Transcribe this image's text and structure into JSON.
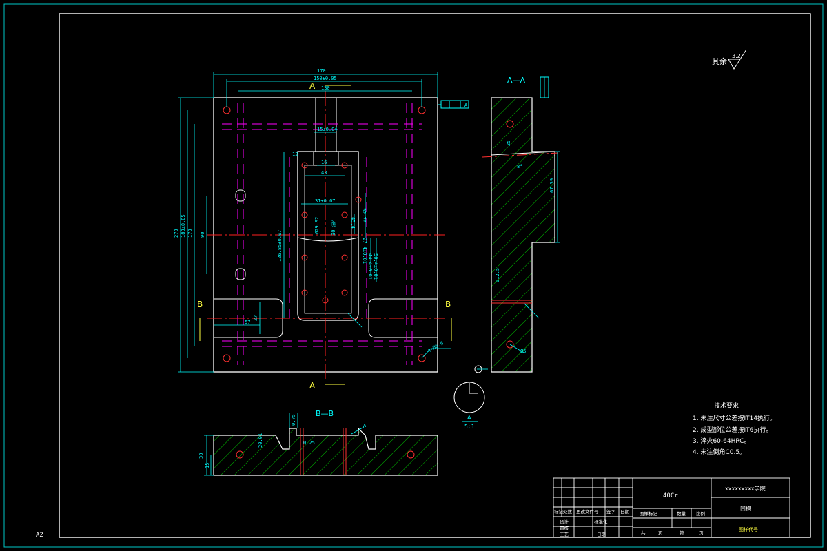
{
  "sheet": {
    "size_label": "A2"
  },
  "roughness": {
    "label": "其余",
    "value": "3.2"
  },
  "sections": {
    "a_top": "A",
    "a_bottom": "A",
    "b_left": "B",
    "b_right": "B",
    "aa_title": "A—A",
    "bb_title": "B—B"
  },
  "dims": {
    "d170": "170",
    "d150": "150±0.05",
    "d130": "130",
    "d15": "15±0.04",
    "d16": "16",
    "d43": "43",
    "d31": "31±0.07",
    "d52": "52.76",
    "d45": "45.4",
    "d29": "Ø29.92",
    "d30": "30 深4",
    "d126": "126.85±0.07",
    "d270": "270",
    "d180": "180±0.05",
    "d170v": "170",
    "d90": "90",
    "d57": "57",
    "d27": "27",
    "d44": "44.4±0.01",
    "d50": "50.4±0.01",
    "d27b": "27.4±0.01",
    "d4r": "4-Ø6.5",
    "dtol": "Ø12.5",
    "d67": "67.59",
    "d8": "8°",
    "d12": "12",
    "d25": "25",
    "d6": "Ø6",
    "d30b": "30",
    "d15b": "15",
    "d20": "20.01",
    "d75": "0.75",
    "d025": "0.25",
    "ref": "A"
  },
  "detail": {
    "label": "A",
    "scale": "5:1"
  },
  "notes": {
    "title": "技术要求",
    "items": [
      "1. 未注尺寸公差按IT14执行。",
      "2. 成型部位公差按IT6执行。",
      "3. 淬火60-64HRC。",
      "4. 未注倒角C0.5。"
    ]
  },
  "title_block": {
    "material": "40Cr",
    "school": "xxxxxxxxx学院",
    "part": "凹模",
    "drawing_no": "图样代号",
    "hdr": [
      "标记",
      "处数",
      "更改文件号",
      "签字",
      "日期"
    ],
    "r2": [
      "设计",
      "",
      "标准化",
      "",
      ""
    ],
    "r3": [
      "审核",
      "",
      "",
      "",
      ""
    ],
    "r4": [
      "工艺",
      "",
      "日期",
      "",
      ""
    ],
    "stage": [
      "图样标记",
      "数量",
      "比例"
    ],
    "sheets": [
      "共",
      "页",
      "第",
      "页"
    ]
  },
  "colors": {
    "border": "#00ffff",
    "outline": "#ffffff",
    "dim": "#00ffff",
    "center": "#ff0000",
    "hidden": "#ff00ff",
    "hatch": "#00ff00",
    "text": "#ffff00"
  }
}
